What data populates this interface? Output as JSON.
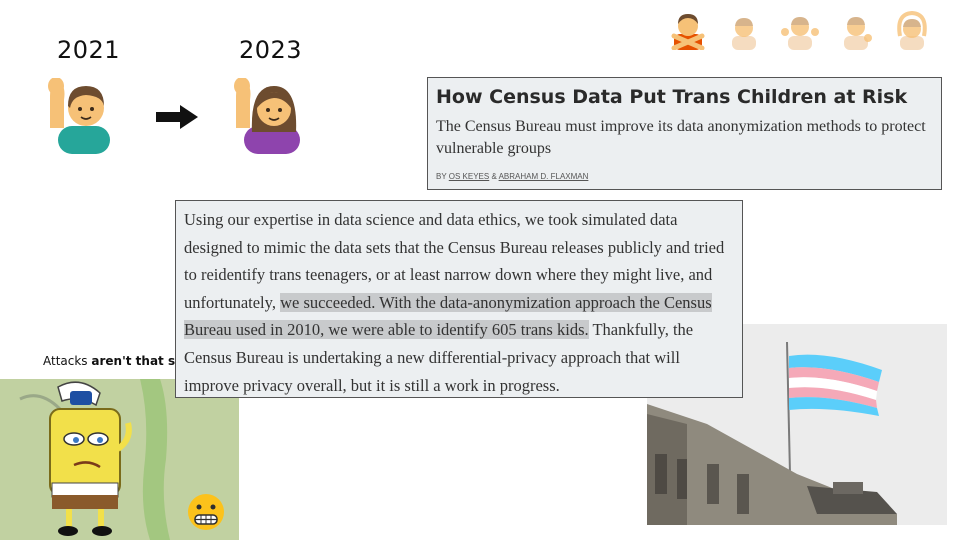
{
  "timeline": {
    "year_before": "2021",
    "year_after": "2023",
    "icons": [
      "man-raising-hand-icon",
      "arrow-right-icon",
      "woman-raising-hand-icon"
    ]
  },
  "reaction_emojis": [
    "person-gesturing-no-icon",
    "person-bowing-icon",
    "person-shrugging-icon",
    "person-tipping-hand-icon",
    "person-gesturing-ok-icon"
  ],
  "article": {
    "title": "How Census Data Put Trans Children at Risk",
    "subtitle": "The Census Bureau must improve its data anonymization methods to protect vulnerable groups",
    "byline_prefix": "BY",
    "author1": "OS KEYES",
    "separator": "&",
    "author2": "ABRAHAM D. FLAXMAN"
  },
  "quote": {
    "part1": "Using our expertise in data science and data ethics, we took simulated data designed to mimic the data sets that the Census Bureau releases publicly and tried to reidentify trans teenagers, or at least narrow down where they might live, and unfortunately, ",
    "highlight": "we succeeded. With the data-anonymization approach the Census Bureau used in 2010, we were able to identify 605 trans kids.",
    "part2": " Thankfully, the Census Bureau is undertaking a new differential-privacy approach that will improve privacy overall, but it is still a work in progress."
  },
  "attacks": {
    "prefix": "Attacks ",
    "bold": "aren't that sc"
  },
  "images": {
    "meme": "spongebob-meme-image",
    "meme_emoji": "grimacing-face-icon",
    "flag": "transgender-flag-photo"
  },
  "colors": {
    "card_bg": "#eceff1",
    "highlight": "#c8cacc",
    "flag_blue": "#5bcefa",
    "flag_pink": "#f5a9b8"
  }
}
